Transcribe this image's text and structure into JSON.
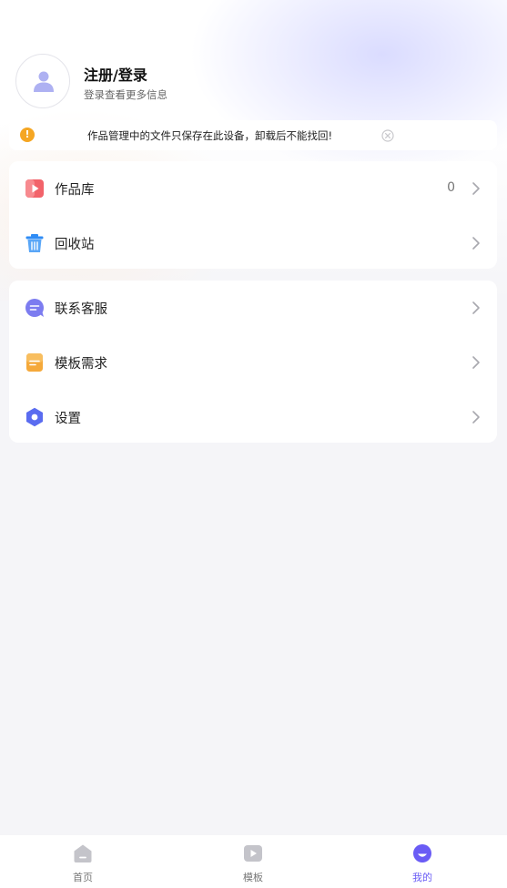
{
  "profile": {
    "title": "注册/登录",
    "subtitle": "登录查看更多信息"
  },
  "notice": {
    "text": "作品管理中的文件只保存在此设备，卸载后不能找回!",
    "warn_glyph": "!",
    "icons": {
      "warn": "warning-icon",
      "close": "close-circle-icon"
    }
  },
  "menu_group_1": [
    {
      "label": "作品库",
      "count": "0",
      "icon": "play-square-icon"
    },
    {
      "label": "回收站",
      "icon": "trash-icon"
    }
  ],
  "menu_group_2": [
    {
      "label": "联系客服",
      "icon": "chat-bubble-icon"
    },
    {
      "label": "模板需求",
      "icon": "document-icon"
    },
    {
      "label": "设置",
      "icon": "hexagon-gear-icon"
    }
  ],
  "tabbar": [
    {
      "label": "首页",
      "icon": "home-icon",
      "active": false
    },
    {
      "label": "模板",
      "icon": "play-icon",
      "active": false
    },
    {
      "label": "我的",
      "icon": "smile-icon",
      "active": true
    }
  ],
  "colors": {
    "accent": "#6a5cf5",
    "warning": "#f5a623",
    "works_icon": "#f2636a",
    "trash_icon": "#2f8cf5",
    "service_icon": "#7c7cf0",
    "template_icon": "#f5a93a",
    "settings_icon": "#5a6cf0"
  }
}
